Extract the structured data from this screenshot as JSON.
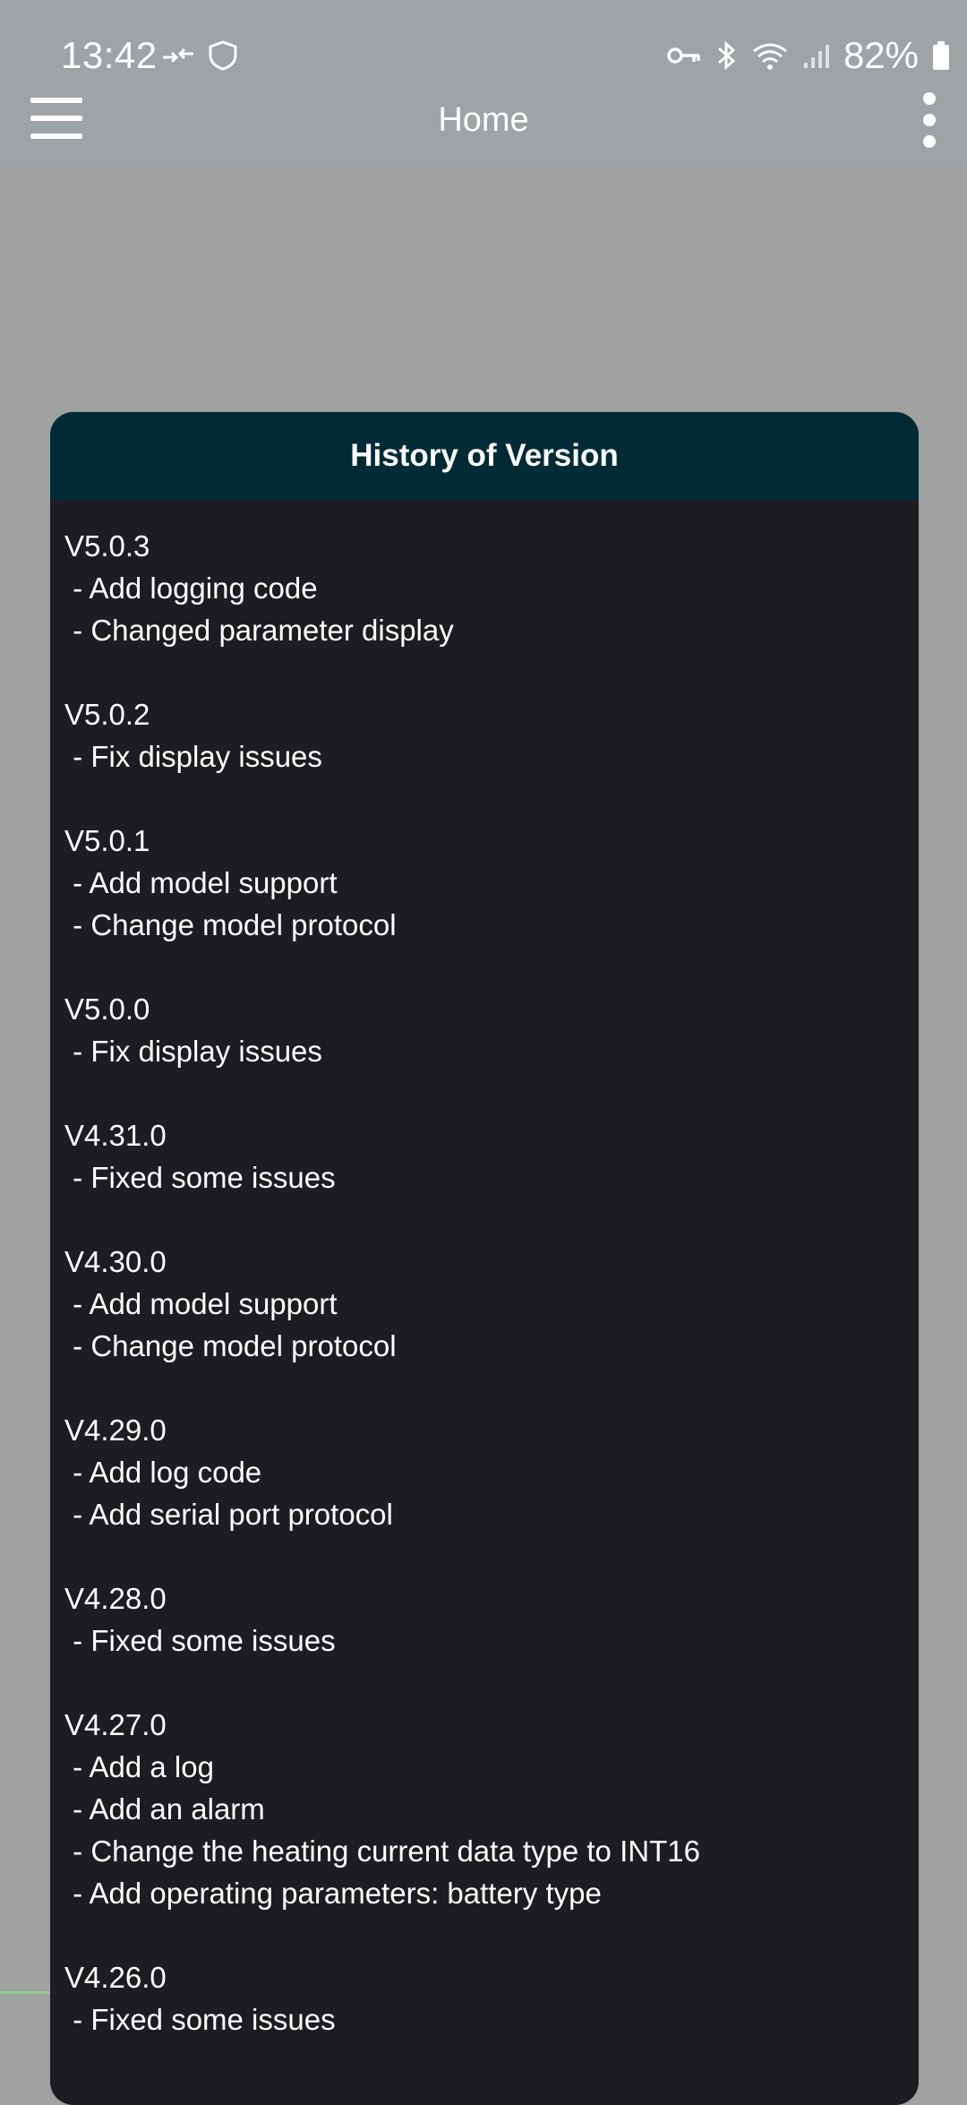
{
  "status_bar": {
    "time": "13:42",
    "battery_percent": "82%",
    "icons": [
      "arrows-icon",
      "shield-icon",
      "key-icon",
      "bluetooth-icon",
      "wifi-icon",
      "signal-icon",
      "battery-icon"
    ]
  },
  "app_bar": {
    "title": "Home",
    "menu_icon": "hamburger-icon",
    "overflow_icon": "more-vert-icon"
  },
  "dialog": {
    "title": "History of Version",
    "versions": [
      {
        "version": "V5.0.3",
        "changes": [
          " - Add logging code",
          " - Changed parameter display"
        ]
      },
      {
        "version": "V5.0.2",
        "changes": [
          " - Fix display issues"
        ]
      },
      {
        "version": "V5.0.1",
        "changes": [
          " - Add model support",
          " - Change model protocol"
        ]
      },
      {
        "version": "V5.0.0",
        "changes": [
          " - Fix display issues"
        ]
      },
      {
        "version": "V4.31.0",
        "changes": [
          " - Fixed some issues"
        ]
      },
      {
        "version": "V4.30.0",
        "changes": [
          " - Add model support",
          " - Change model protocol"
        ]
      },
      {
        "version": "V4.29.0",
        "changes": [
          " - Add log code",
          " - Add serial port protocol"
        ]
      },
      {
        "version": "V4.28.0",
        "changes": [
          " - Fixed some issues"
        ]
      },
      {
        "version": "V4.27.0",
        "changes": [
          " - Add a log",
          " - Add an alarm",
          " - Change the heating current data type to INT16",
          " - Add operating parameters: battery type"
        ]
      },
      {
        "version": "V4.26.0",
        "changes": [
          " - Fixed some issues"
        ]
      }
    ]
  },
  "colors": {
    "status_bar_bg": "#9ea3a6",
    "page_bg": "#a0a1a1",
    "dialog_header_bg": "#002a35",
    "dialog_body_bg": "#1d1d21"
  }
}
